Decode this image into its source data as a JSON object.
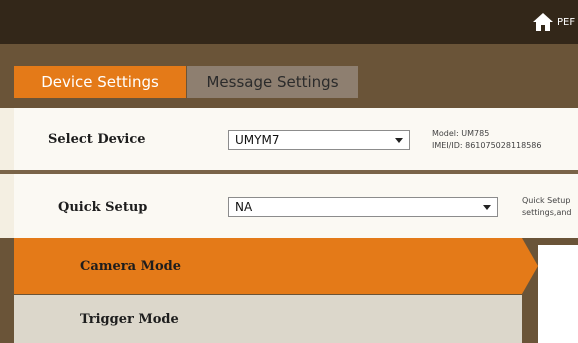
{
  "header": {
    "home_label": "PEF"
  },
  "tabs": [
    {
      "label": "Device Settings",
      "active": true
    },
    {
      "label": "Message Settings",
      "active": false
    }
  ],
  "select_device": {
    "label": "Select Device",
    "value": "UMYM7",
    "model_line": "Model: UM785",
    "imei_line": "IMEI/ID: 861075028118586"
  },
  "quick_setup": {
    "label": "Quick Setup",
    "value": "NA",
    "info_line1": "Quick Setup",
    "info_line2": "settings,and"
  },
  "modes": [
    {
      "label": "Camera Mode",
      "active": true
    },
    {
      "label": "Trigger Mode",
      "active": false
    }
  ],
  "colors": {
    "accent": "#e47a18",
    "topbar": "#332719",
    "band": "#6a5438"
  }
}
